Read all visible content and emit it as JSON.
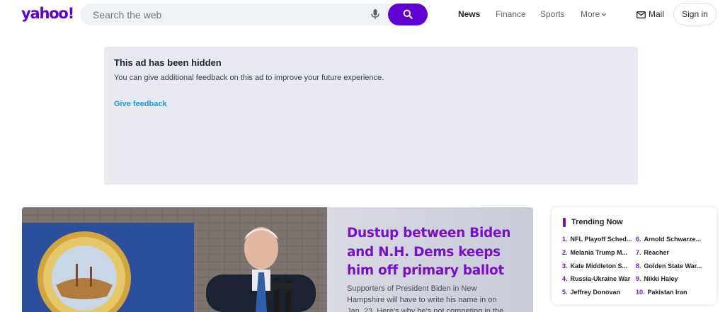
{
  "header": {
    "logo": "yahoo!",
    "search": {
      "placeholder": "Search the web",
      "value": ""
    },
    "nav": [
      "News",
      "Finance",
      "Sports",
      "More"
    ],
    "mail_label": "Mail",
    "signin_label": "Sign in"
  },
  "ad": {
    "title": "This ad has been hidden",
    "message": "You can give additional feedback on this ad to improve your future experience.",
    "feedback_label": "Give feedback"
  },
  "hero": {
    "headline": "Dustup between Biden and N.H. Dems keeps him off primary ballot",
    "summary": "Supporters of President Biden in New Hampshire will have to write his name in on Jan. 23. Here's why he's not competing in the"
  },
  "trending": {
    "title": "Trending Now",
    "items": [
      {
        "num": "1.",
        "label": "NFL Playoff Sched..."
      },
      {
        "num": "2.",
        "label": "Melania Trump M..."
      },
      {
        "num": "3.",
        "label": "Kate Middleton S..."
      },
      {
        "num": "4.",
        "label": "Russia-Ukraine War"
      },
      {
        "num": "5.",
        "label": "Jeffrey Donovan"
      },
      {
        "num": "6.",
        "label": "Arnold Schwarze..."
      },
      {
        "num": "7.",
        "label": "Reacher"
      },
      {
        "num": "8.",
        "label": "Golden State War..."
      },
      {
        "num": "9.",
        "label": "Nikki Haley"
      },
      {
        "num": "10.",
        "label": "Pakistan Iran"
      }
    ]
  },
  "colors": {
    "brand": "#6001d2",
    "accent": "#7810ca",
    "link": "#1a9ad9",
    "ad_background": "#e8e9f1"
  }
}
